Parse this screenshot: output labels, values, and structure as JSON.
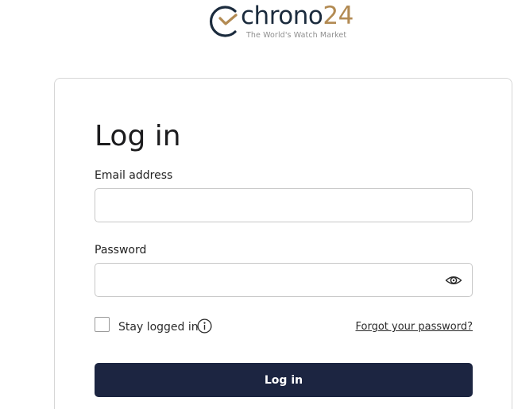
{
  "logo": {
    "word": "chrono",
    "number": "24",
    "tagline": "The World's Watch Market",
    "colors": {
      "dark": "#1b2b3d",
      "gold": "#b28a52"
    }
  },
  "login": {
    "title": "Log in",
    "email_label": "Email address",
    "email_value": "",
    "email_placeholder": "",
    "password_label": "Password",
    "password_value": "",
    "password_placeholder": "",
    "password_toggle_icon": "eye-icon",
    "stay_logged_in_label": "Stay logged in",
    "stay_logged_in_checked": false,
    "info_icon": "info-icon",
    "forgot_password_link": "Forgot your password?",
    "submit_label": "Log in",
    "colors": {
      "button_bg": "#1c2541",
      "button_text": "#ffffff",
      "border": "#c7c7c7"
    }
  }
}
